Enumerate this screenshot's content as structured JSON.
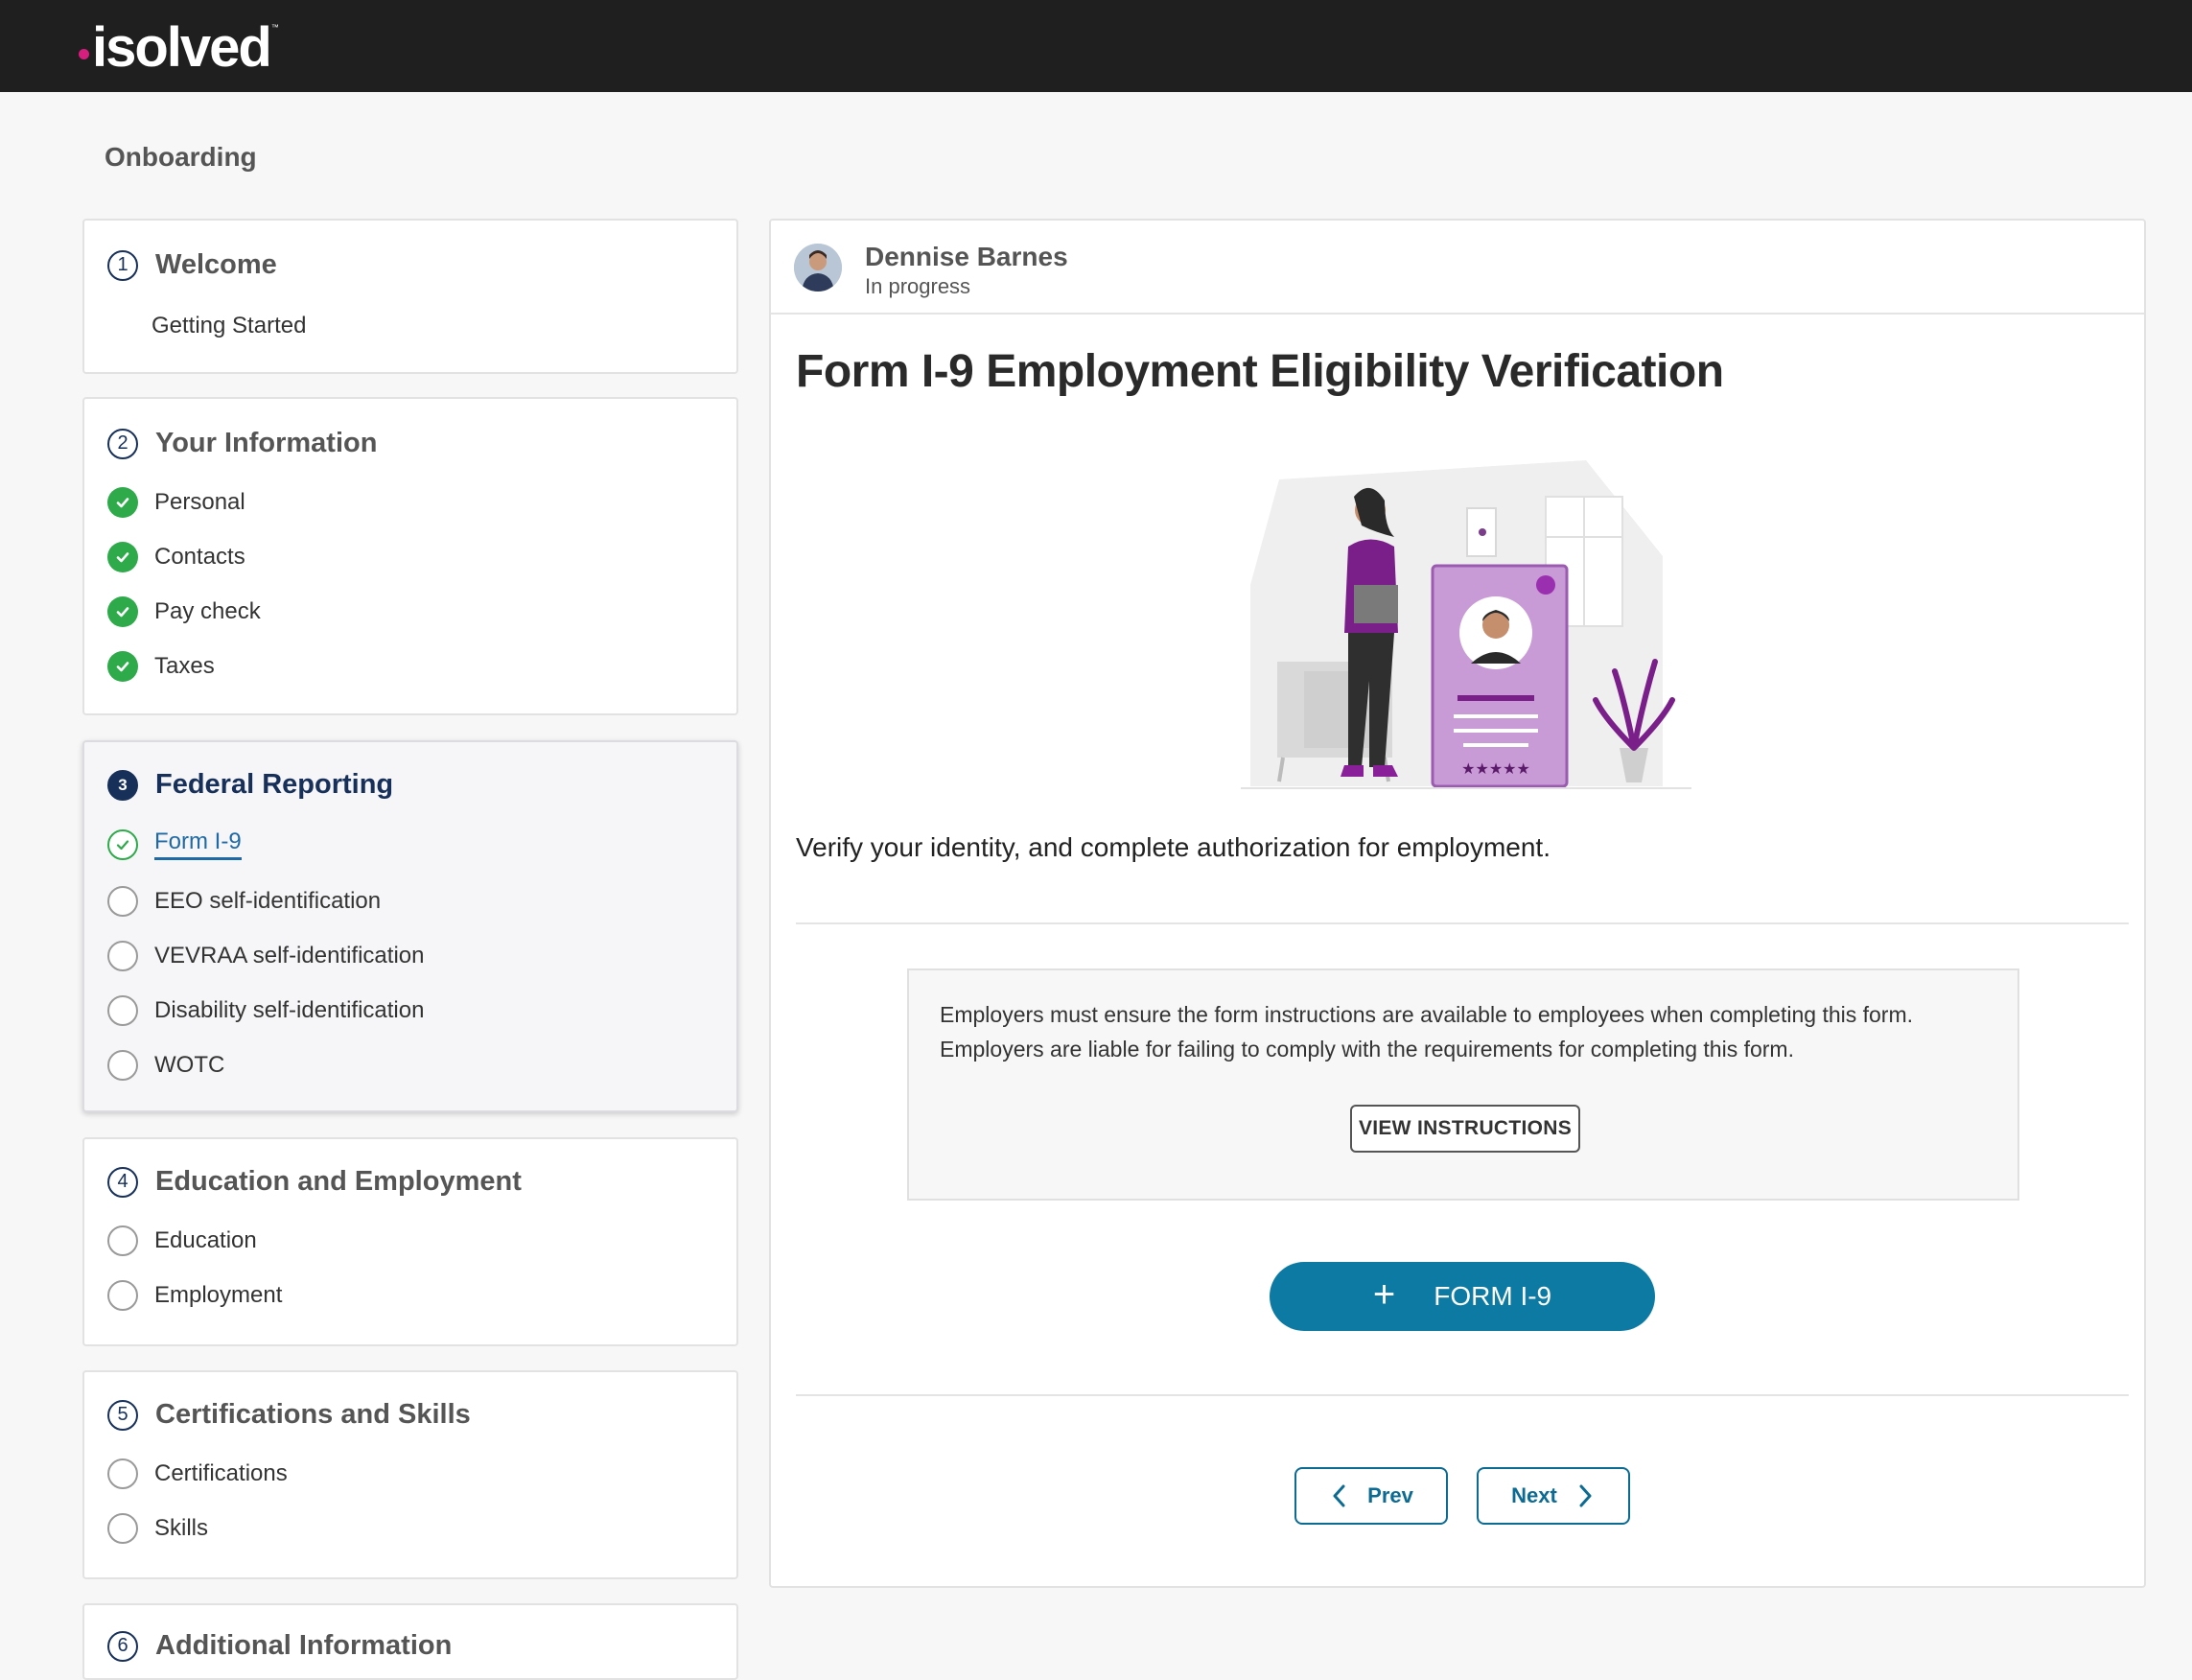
{
  "brand": {
    "name": "isolved",
    "accent": "#d61e7e",
    "bar": "#1f1f1f"
  },
  "page": {
    "title": "Onboarding"
  },
  "steps": [
    {
      "num": "1",
      "title": "Welcome",
      "sub": "Getting Started"
    },
    {
      "num": "2",
      "title": "Your Information",
      "items": [
        "Personal",
        "Contacts",
        "Pay check",
        "Taxes"
      ],
      "state": "complete"
    },
    {
      "num": "3",
      "title": "Federal Reporting",
      "items": [
        "Form I-9",
        "EEO self-identification",
        "VEVRAA self-identification",
        "Disability self-identification",
        "WOTC"
      ],
      "state": "active"
    },
    {
      "num": "4",
      "title": "Education and Employment",
      "items": [
        "Education",
        "Employment"
      ]
    },
    {
      "num": "5",
      "title": "Certifications and Skills",
      "items": [
        "Certifications",
        "Skills"
      ]
    },
    {
      "num": "6",
      "title": "Additional Information"
    }
  ],
  "user": {
    "name": "Dennise Barnes",
    "status": "In progress"
  },
  "form": {
    "title": "Form I-9 Employment Eligibility Verification",
    "description": "Verify your identity, and complete authorization for employment.",
    "notice_line1": "Employers must ensure the form instructions are available to employees when completing this form.",
    "notice_line2": "Employers are liable for failing to comply with the requirements for completing this form.",
    "view_instructions": "VIEW INSTRUCTIONS",
    "add_button": "FORM I-9",
    "prev": "Prev",
    "next": "Next"
  },
  "icons": {
    "check": "check-icon",
    "plus": "plus-icon",
    "chevron_left": "chevron-left-icon",
    "chevron_right": "chevron-right-icon"
  },
  "colors": {
    "primary": "#0c7aa3",
    "success": "#2eaa4a",
    "step_active": "#17305a",
    "link": "#1f6aa5"
  }
}
